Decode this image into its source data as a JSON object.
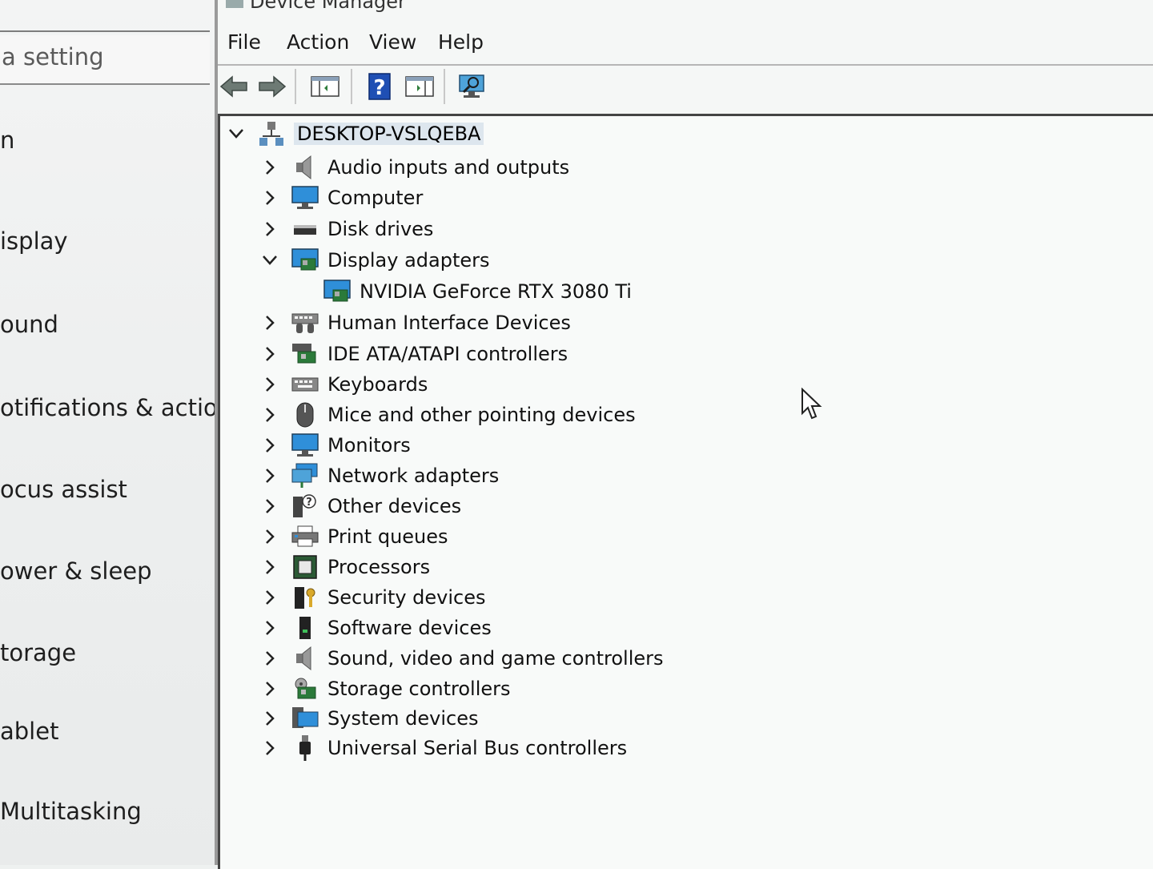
{
  "settings": {
    "search_placeholder": "a setting",
    "nav": [
      {
        "label": "n"
      },
      {
        "label": "isplay"
      },
      {
        "label": "ound"
      },
      {
        "label": "otifications & action"
      },
      {
        "label": "ocus assist"
      },
      {
        "label": "ower & sleep"
      },
      {
        "label": "torage"
      },
      {
        "label": "ablet"
      },
      {
        "label": "Multitasking"
      }
    ]
  },
  "device_manager": {
    "window_title": "Device Manager",
    "menu": [
      {
        "label": "File"
      },
      {
        "label": "Action"
      },
      {
        "label": "View"
      },
      {
        "label": "Help"
      }
    ],
    "toolbar": {
      "buttons": [
        {
          "icon": "back-arrow-icon"
        },
        {
          "icon": "forward-arrow-icon"
        },
        {
          "icon": "show-hide-console-tree-icon"
        },
        {
          "icon": "help-icon"
        },
        {
          "icon": "properties-icon"
        },
        {
          "icon": "scan-hardware-changes-icon"
        }
      ]
    },
    "tree": {
      "root": {
        "label": "DESKTOP-VSLQEBA",
        "expanded": true,
        "icon": "computer-network-icon"
      },
      "items": [
        {
          "label": "Audio inputs and outputs",
          "icon": "speaker-icon",
          "expanded": false
        },
        {
          "label": "Computer",
          "icon": "monitor-icon",
          "expanded": false
        },
        {
          "label": "Disk drives",
          "icon": "disk-drive-icon",
          "expanded": false
        },
        {
          "label": "Display adapters",
          "icon": "display-adapter-icon",
          "expanded": true,
          "children": [
            {
              "label": "NVIDIA GeForce RTX 3080 Ti",
              "icon": "display-adapter-icon"
            }
          ]
        },
        {
          "label": "Human Interface Devices",
          "icon": "hid-icon",
          "expanded": false
        },
        {
          "label": "IDE ATA/ATAPI controllers",
          "icon": "ide-controller-icon",
          "expanded": false
        },
        {
          "label": "Keyboards",
          "icon": "keyboard-icon",
          "expanded": false
        },
        {
          "label": "Mice and other pointing devices",
          "icon": "mouse-icon",
          "expanded": false
        },
        {
          "label": "Monitors",
          "icon": "monitor-icon",
          "expanded": false
        },
        {
          "label": "Network adapters",
          "icon": "network-adapter-icon",
          "expanded": false
        },
        {
          "label": "Other devices",
          "icon": "unknown-device-icon",
          "expanded": false
        },
        {
          "label": "Print queues",
          "icon": "printer-icon",
          "expanded": false
        },
        {
          "label": "Processors",
          "icon": "processor-icon",
          "expanded": false
        },
        {
          "label": "Security devices",
          "icon": "security-device-icon",
          "expanded": false
        },
        {
          "label": "Software devices",
          "icon": "software-device-icon",
          "expanded": false
        },
        {
          "label": "Sound, video and game controllers",
          "icon": "speaker-icon",
          "expanded": false
        },
        {
          "label": "Storage controllers",
          "icon": "storage-controller-icon",
          "expanded": false
        },
        {
          "label": "System devices",
          "icon": "system-device-icon",
          "expanded": false
        },
        {
          "label": "Universal Serial Bus controllers",
          "icon": "usb-icon",
          "expanded": false
        }
      ]
    }
  }
}
